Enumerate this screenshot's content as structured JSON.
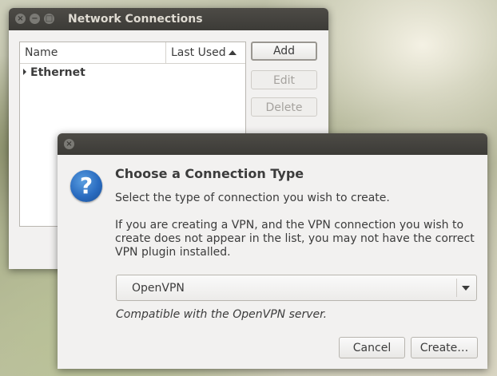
{
  "main_window": {
    "title": "Network Connections",
    "columns": [
      "Name",
      "Last Used"
    ],
    "sort_indicator": "sort-ascending-icon",
    "rows": [
      {
        "label": "Ethernet",
        "expandable": true
      }
    ],
    "buttons": {
      "add": "Add",
      "edit": "Edit",
      "delete": "Delete"
    }
  },
  "dialog": {
    "heading": "Choose a Connection Type",
    "subheading": "Select the type of connection you wish to create.",
    "info": "If you are creating a VPN, and the VPN connection you wish to create does not appear in the list, you may not have the correct VPN plugin installed.",
    "selected_type": "OpenVPN",
    "description": "Compatible with the OpenVPN server.",
    "buttons": {
      "cancel": "Cancel",
      "create": "Create…"
    }
  },
  "colors": {
    "titlebar": "#3c3b37",
    "window_bg": "#f2f1f0",
    "icon_blue": "#2a6cc0"
  }
}
